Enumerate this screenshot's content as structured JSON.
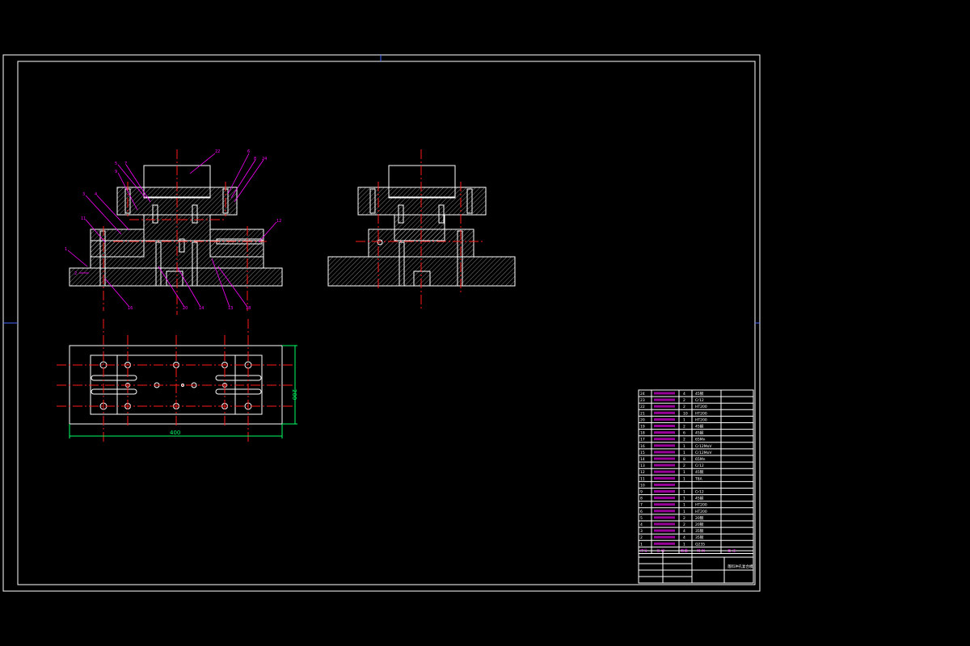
{
  "drawing": {
    "dimensions": {
      "length": "400",
      "width": "200"
    },
    "labels_left_view": [
      "1",
      "2",
      "3",
      "4",
      "5",
      "6",
      "7",
      "8",
      "9",
      "10",
      "11",
      "12",
      "13",
      "14",
      "15",
      "16",
      "17",
      "18",
      "19",
      "20"
    ],
    "bom_rows": [
      {
        "no": "24",
        "qty": "4",
        "material": "45钢",
        "note": ""
      },
      {
        "no": "23",
        "qty": "2",
        "material": "Cr12",
        "note": ""
      },
      {
        "no": "22",
        "qty": "2",
        "material": "HT200",
        "note": ""
      },
      {
        "no": "21",
        "qty": "10",
        "material": "HT200",
        "note": ""
      },
      {
        "no": "20",
        "qty": "1",
        "material": "HT200",
        "note": ""
      },
      {
        "no": "19",
        "qty": "2",
        "material": "45钢",
        "note": ""
      },
      {
        "no": "18",
        "qty": "6",
        "material": "45钢",
        "note": ""
      },
      {
        "no": "17",
        "qty": "2",
        "material": "65Mn",
        "note": ""
      },
      {
        "no": "16",
        "qty": "1",
        "material": "Cr12MoV",
        "note": ""
      },
      {
        "no": "15",
        "qty": "1",
        "material": "Cr12MoV",
        "note": ""
      },
      {
        "no": "14",
        "qty": "8",
        "material": "65Mn",
        "note": ""
      },
      {
        "no": "13",
        "qty": "2",
        "material": "Cr12",
        "note": ""
      },
      {
        "no": "12",
        "qty": "1",
        "material": "45钢",
        "note": ""
      },
      {
        "no": "11",
        "qty": "1",
        "material": "T8A",
        "note": ""
      },
      {
        "no": "10",
        "qty": "",
        "material": "",
        "note": ""
      },
      {
        "no": "9",
        "qty": "1",
        "material": "Cr12",
        "note": ""
      },
      {
        "no": "8",
        "qty": "1",
        "material": "45钢",
        "note": ""
      },
      {
        "no": "7",
        "qty": "1",
        "material": "HT200",
        "note": ""
      },
      {
        "no": "6",
        "qty": "1",
        "material": "HT200",
        "note": ""
      },
      {
        "no": "5",
        "qty": "2",
        "material": "20钢",
        "note": ""
      },
      {
        "no": "4",
        "qty": "2",
        "material": "20钢",
        "note": ""
      },
      {
        "no": "3",
        "qty": "4",
        "material": "35钢",
        "note": ""
      },
      {
        "no": "2",
        "qty": "4",
        "material": "35钢",
        "note": ""
      },
      {
        "no": "1",
        "qty": "1",
        "material": "Q235",
        "note": ""
      }
    ],
    "bom_header": {
      "no": "序号",
      "name": "名 称",
      "qty": "数量",
      "material": "材 料",
      "note": "备 注"
    },
    "title_block": {
      "title": "落料冲孔复合模"
    }
  }
}
